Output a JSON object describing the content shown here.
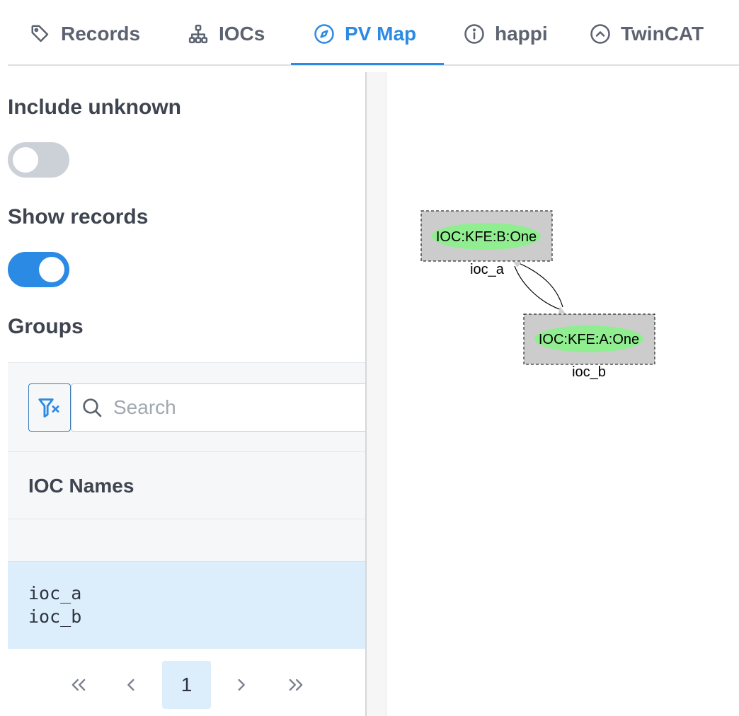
{
  "tabs": [
    {
      "label": "Records",
      "icon": "tag-icon",
      "active": false
    },
    {
      "label": "IOCs",
      "icon": "sitemap-icon",
      "active": false
    },
    {
      "label": "PV Map",
      "icon": "compass-icon",
      "active": true
    },
    {
      "label": "happi",
      "icon": "info-circle-icon",
      "active": false
    },
    {
      "label": "TwinCAT",
      "icon": "chevron-up-circle-icon",
      "active": false
    }
  ],
  "options": {
    "include_unknown": {
      "label": "Include unknown",
      "on": false
    },
    "show_records": {
      "label": "Show records",
      "on": true
    }
  },
  "groups": {
    "label": "Groups",
    "search_placeholder": "Search",
    "column_header": "IOC Names",
    "selected_rows": [
      "ioc_a",
      "ioc_b"
    ]
  },
  "pagination": {
    "first": "«",
    "prev": "‹",
    "current_page": "1",
    "next": "›",
    "last": "»"
  },
  "graph": {
    "nodes": [
      {
        "cluster": "ioc_a",
        "pv": "IOC:KFE:B:One"
      },
      {
        "cluster": "ioc_b",
        "pv": "IOC:KFE:A:One"
      }
    ],
    "colors": {
      "cluster_fill": "#cccccc",
      "node_fill": "#90ee90",
      "accent": "#2b8ae3"
    }
  }
}
